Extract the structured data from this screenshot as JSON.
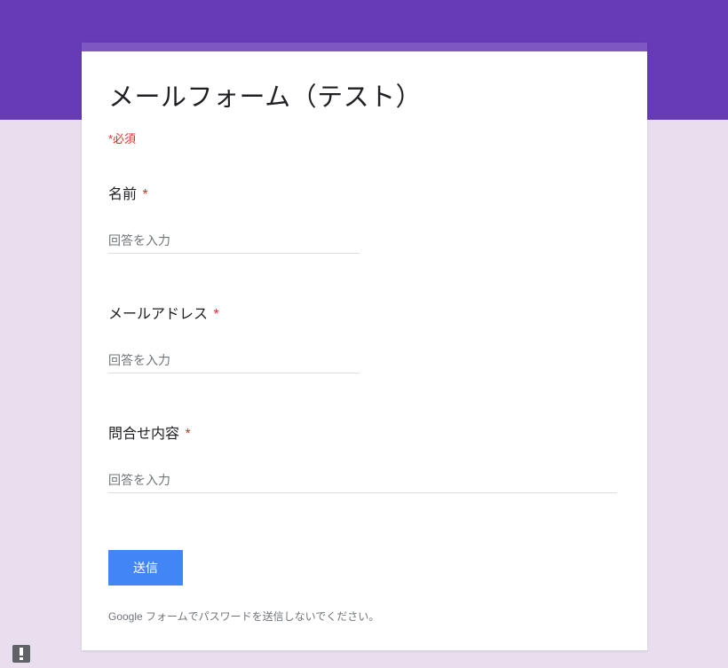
{
  "form": {
    "title": "メールフォーム（テスト）",
    "required_note": "*必須",
    "questions": [
      {
        "label": "名前",
        "placeholder": "回答を入力",
        "required": true,
        "long": false
      },
      {
        "label": "メールアドレス",
        "placeholder": "回答を入力",
        "required": true,
        "long": false
      },
      {
        "label": "問合せ内容",
        "placeholder": "回答を入力",
        "required": true,
        "long": true
      }
    ],
    "submit_label": "送信",
    "disclaimer": "Google フォームでパスワードを送信しないでください。"
  },
  "asterisk": "*"
}
